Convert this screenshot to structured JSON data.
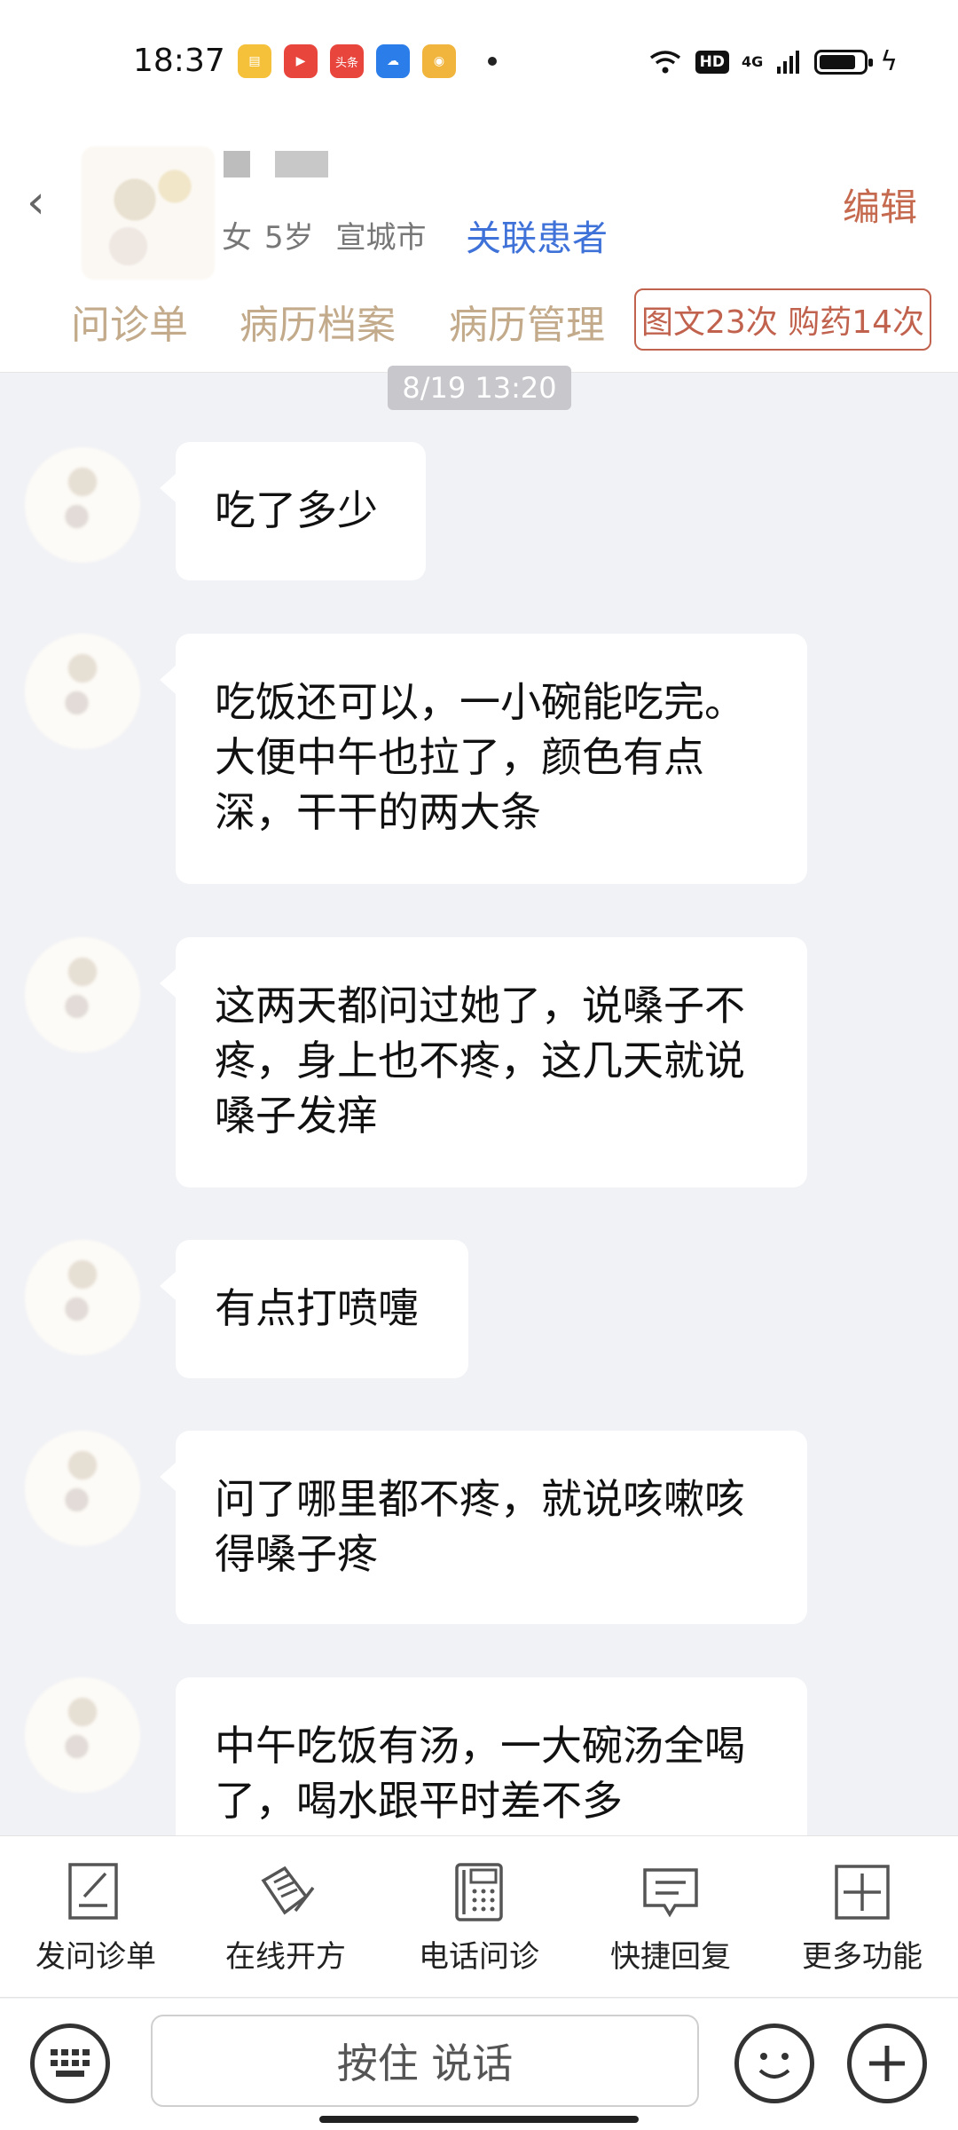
{
  "status_bar": {
    "time": "18:37",
    "apps": [
      "note-app-icon",
      "video-app-icon",
      "toutiao-icon",
      "cloud-app-icon",
      "weibo-icon"
    ],
    "toutiao_label": "头条",
    "hd": "HD",
    "network": "4G"
  },
  "header": {
    "patient_gender": "女",
    "patient_age": "5岁",
    "patient_city": "宣城市",
    "link_patient": "关联患者",
    "edit": "编辑"
  },
  "tabs": [
    {
      "label": "问诊单"
    },
    {
      "label": "病历档案"
    },
    {
      "label": "病历管理"
    }
  ],
  "stats": "图文23次 购药14次",
  "chat": {
    "timestamp": "8/19 13:20",
    "messages": [
      {
        "lines": [
          "吃了多少"
        ]
      },
      {
        "lines": [
          "吃饭还可以，一小碗能吃完。",
          "大便中午也拉了，颜色有点",
          "深，干干的两大条"
        ]
      },
      {
        "lines": [
          "这两天都问过她了，说嗓子不",
          "疼，身上也不疼，这几天就说",
          "嗓子发痒"
        ]
      },
      {
        "lines": [
          "有点打喷嚏"
        ]
      },
      {
        "lines": [
          "问了哪里都不疼，就说咳嗽咳",
          "得嗓子疼"
        ]
      },
      {
        "lines": [
          "中午吃饭有汤，一大碗汤全喝",
          "了，喝水跟平时差不多"
        ]
      }
    ]
  },
  "toolbar": {
    "items": [
      {
        "label": "发问诊单",
        "icon": "form-edit-icon"
      },
      {
        "label": "在线开方",
        "icon": "prescription-icon"
      },
      {
        "label": "电话问诊",
        "icon": "phone-icon"
      },
      {
        "label": "快捷回复",
        "icon": "quick-reply-icon"
      },
      {
        "label": "更多功能",
        "icon": "more-plus-icon"
      }
    ]
  },
  "input": {
    "voice_label": "按住 说话"
  },
  "colors": {
    "accent_blue": "#3f72d8",
    "accent_red": "#c0624d",
    "tab_gold": "#c2aa8b",
    "chat_bg": "#f1f2f6"
  }
}
